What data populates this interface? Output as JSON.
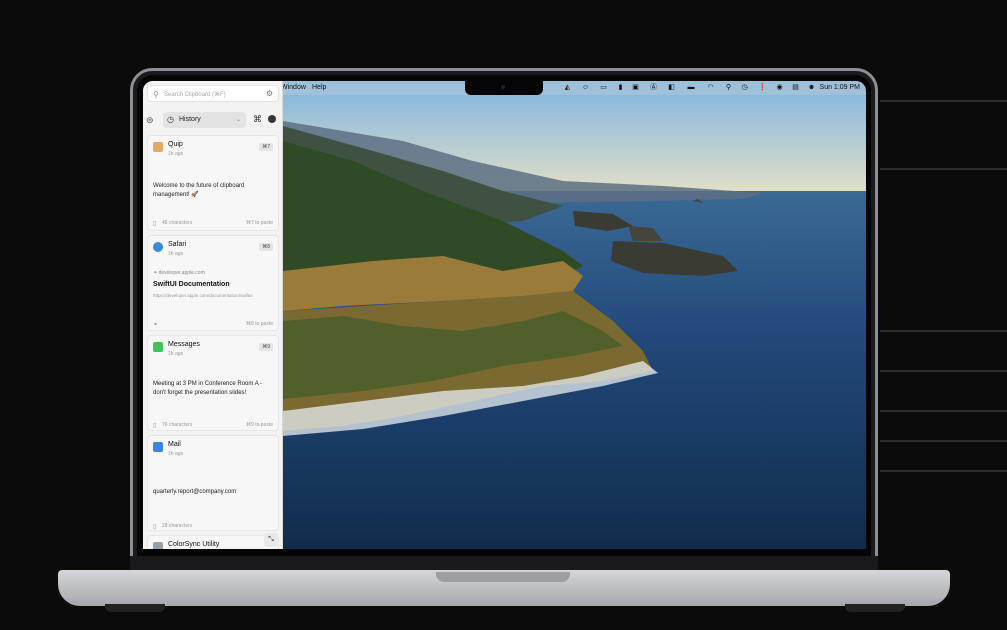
{
  "menubar": {
    "items": [
      "Window",
      "Help"
    ],
    "clock": "Sun 1:09 PM",
    "tray_icons": [
      "fox-icon",
      "face-icon",
      "window-icon",
      "bookmark-icon",
      "box-icon",
      "a-icon",
      "window2-icon",
      "battery-icon",
      "wifi-icon",
      "search-icon",
      "history-icon",
      "exclamation-icon",
      "record-icon",
      "display-icon",
      "person-icon"
    ]
  },
  "panel": {
    "search_placeholder": "Search Clipboard (⌘F)",
    "dropdown_label": "History",
    "cards": [
      {
        "app": "Quip",
        "time": "1h ago",
        "shortcut": "⌘7",
        "text": "Welcome to the future of clipboard management! 🚀",
        "chars": "48 characters",
        "paste": "⌘7 to paste"
      },
      {
        "app": "Safari",
        "time": "1h ago",
        "shortcut": "⌘8",
        "link_domain": "developer.apple.com",
        "link_title": "SwiftUI Documentation",
        "link_url": "https://developer.apple.com/documentation/swiftui",
        "paste": "⌘8 to paste"
      },
      {
        "app": "Messages",
        "time": "1h ago",
        "shortcut": "⌘9",
        "text": "Meeting at 3 PM in Conference Room A - don't forget the presentation slides!",
        "chars": "76 characters",
        "paste": "⌘9 to paste"
      },
      {
        "app": "Mail",
        "time": "1h ago",
        "text": "quarterly.report@company.com",
        "chars": "28 characters"
      },
      {
        "app": "ColorSync Utility"
      }
    ]
  },
  "colors": {
    "sky": "#8fc2e3",
    "sea": "#1d3f68",
    "cliff": "#6b5a2a",
    "forest": "#2f4a25"
  }
}
